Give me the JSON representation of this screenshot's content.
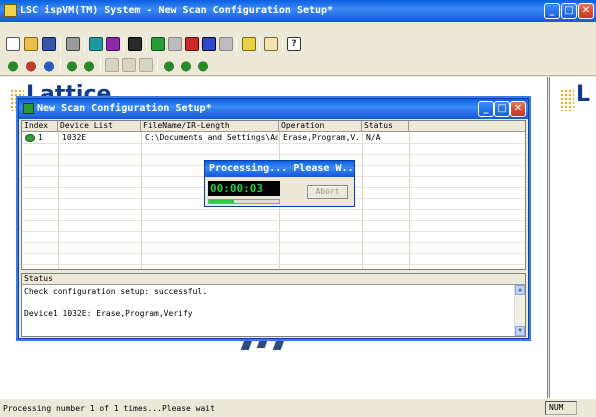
{
  "window": {
    "title": "LSC ispVM(TM) System - New Scan Configuration Setup*",
    "minimize": "_",
    "restore": "□",
    "close": "✕"
  },
  "toolbar_row1": [
    {
      "name": "new-doc-icon"
    },
    {
      "name": "open-folder-icon"
    },
    {
      "name": "save-icon"
    },
    {
      "name": "print-icon"
    },
    {
      "name": "scan-icon"
    },
    {
      "name": "nvscan-icon"
    },
    {
      "name": "dark-app-icon"
    },
    {
      "name": "go-icon"
    },
    {
      "name": "svf-icon"
    },
    {
      "name": "ate-icon"
    },
    {
      "name": "isc-icon"
    },
    {
      "name": "grey-tool-icon"
    },
    {
      "name": "vm-icon"
    },
    {
      "name": "clipboard-icon"
    },
    {
      "name": "help-icon"
    }
  ],
  "toolbar_row2": [
    {
      "name": "chip-green-icon"
    },
    {
      "name": "chip-red-icon"
    },
    {
      "name": "chip-blue-icon"
    },
    {
      "name": "chip-add-icon"
    },
    {
      "name": "chip-edit-icon"
    },
    {
      "name": "cut-icon"
    },
    {
      "name": "copy-icon"
    },
    {
      "name": "paste-icon"
    },
    {
      "name": "chip-up-icon"
    },
    {
      "name": "chip-down-icon"
    },
    {
      "name": "chip-right-icon"
    }
  ],
  "workspace": {
    "logo_text": "Lattice",
    "logo_text_right": "L"
  },
  "dialog": {
    "title": "New Scan Configuration Setup*",
    "columns": [
      "Index",
      "Device List",
      "FileName/IR-Length",
      "Operation",
      "Status"
    ],
    "rows": [
      {
        "index": "1",
        "device": "1032E",
        "file": "C:\\Documents and Settings\\Ad...",
        "operation": "Erase,Program,V...",
        "status": "N/A"
      }
    ],
    "status_header": "Status",
    "status_lines": [
      "Check configuration setup: successful.",
      "",
      "Device1 1032E: Erase,Program,Verify"
    ]
  },
  "processing": {
    "title": "Processing... Please W...",
    "elapsed": "00:00:03",
    "abort_label": "Abort",
    "progress": 0.35,
    "accent": "#2ec94a"
  },
  "statusbar": {
    "message": "Processing number 1 of 1 times...Please wait",
    "num": "NUM"
  }
}
